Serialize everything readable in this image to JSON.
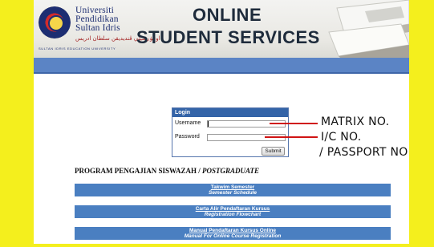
{
  "header": {
    "uni_lines": [
      "Universiti",
      "Pendidikan",
      "Sultan Idris"
    ],
    "uni_arabic": "اونيۏرسيتي ڤنديديقن سلطان ادريس",
    "uni_sub": "SULTAN IDRIS EDUCATION UNIVERSITY",
    "title_line1": "ONLINE",
    "title_line2": "STUDENT SERVICES"
  },
  "login": {
    "title": "Login",
    "username_label": "Username",
    "password_label": "Password",
    "username_value": "",
    "password_value": "",
    "submit_label": "Submit"
  },
  "program": {
    "heading_normal": "PROGRAM PENGAJIAN SISWAZAH / ",
    "heading_italic": "POSTGRADUATE"
  },
  "links": [
    {
      "line1": "Takwim Semester",
      "line2": "Semester Schedule"
    },
    {
      "line1": "Carta Alir Pendaftaran Kursus",
      "line2": "Registration Flowchart"
    },
    {
      "line1": "Manual Pendaftaran Kursus Online",
      "line2": "Manual For Online Course Registration"
    }
  ],
  "annotations": {
    "matrix": "MATRIX NO.",
    "ic": "I/C NO.",
    "passport": "/ PASSPORT NO"
  },
  "colors": {
    "frame": "#f4ef1d",
    "header_bar": "#5b84c5",
    "link_bar": "#4a7fc1",
    "annotation_line": "#d01414"
  }
}
